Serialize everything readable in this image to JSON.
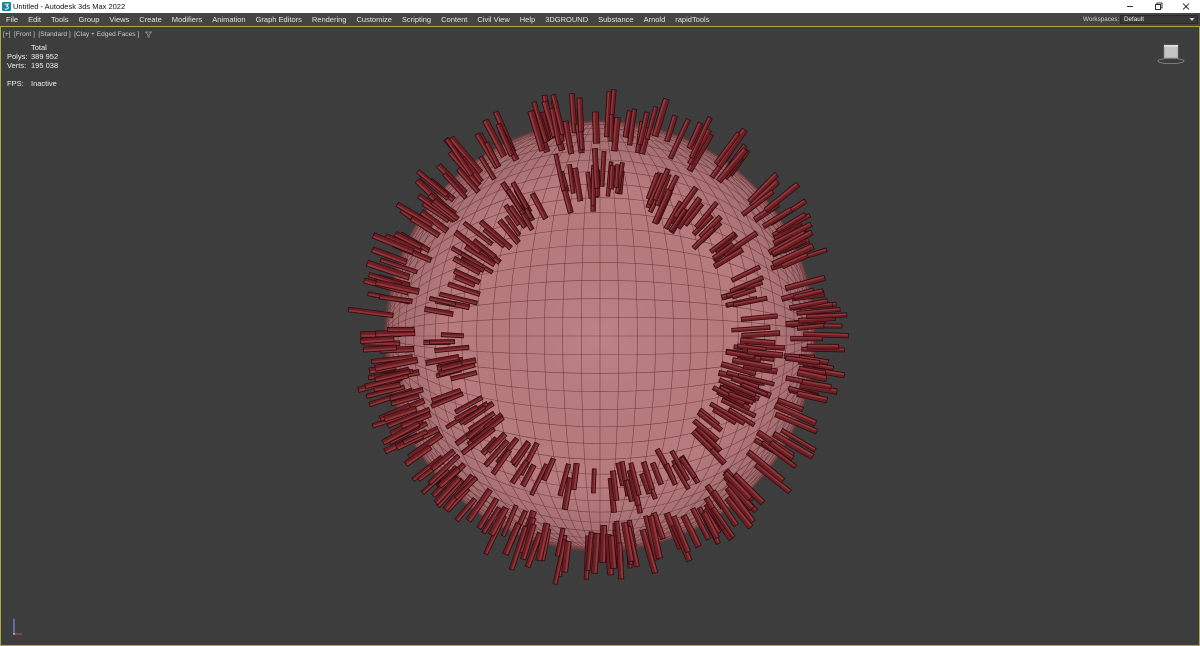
{
  "window": {
    "title": "Untitled - Autodesk 3ds Max 2022",
    "icons": {
      "app": "3ds-max-app-icon",
      "minimize": "minimize-icon",
      "restore": "restore-icon",
      "close": "close-icon"
    }
  },
  "menu": {
    "items": [
      "File",
      "Edit",
      "Tools",
      "Group",
      "Views",
      "Create",
      "Modifiers",
      "Animation",
      "Graph Editors",
      "Rendering",
      "Customize",
      "Scripting",
      "Content",
      "Civil View",
      "Help",
      "3DGROUND",
      "Substance",
      "Arnold",
      "rapidTools"
    ]
  },
  "workspaces": {
    "label": "Workspaces:",
    "value": "Default",
    "icon": "chevron-down-icon"
  },
  "viewport": {
    "label_menus": [
      "[+]",
      "[Front ]",
      "[Standard ]",
      "[Clay + Edged Faces ]"
    ],
    "filter_icon": "funnel-icon",
    "stats": {
      "header": "Total",
      "polys_label": "Polys:",
      "polys_value": "389 952",
      "verts_label": "Verts:",
      "verts_value": "195 038",
      "fps_label": "FPS:",
      "fps_value": "Inactive"
    },
    "viewcube_icon": "viewcube-icon",
    "axis_icon": "axis-tripod-icon"
  },
  "colors": {
    "viewport_background": "#3d3d3d",
    "active_viewport_border": "#b3a640",
    "clay": "#b87b7e",
    "clay_edge": "#6a3a3d",
    "cylinder": "#6b1f24",
    "cylinder_edge": "#2c0a0c",
    "cylinder_highlight": "#9c3e43"
  }
}
